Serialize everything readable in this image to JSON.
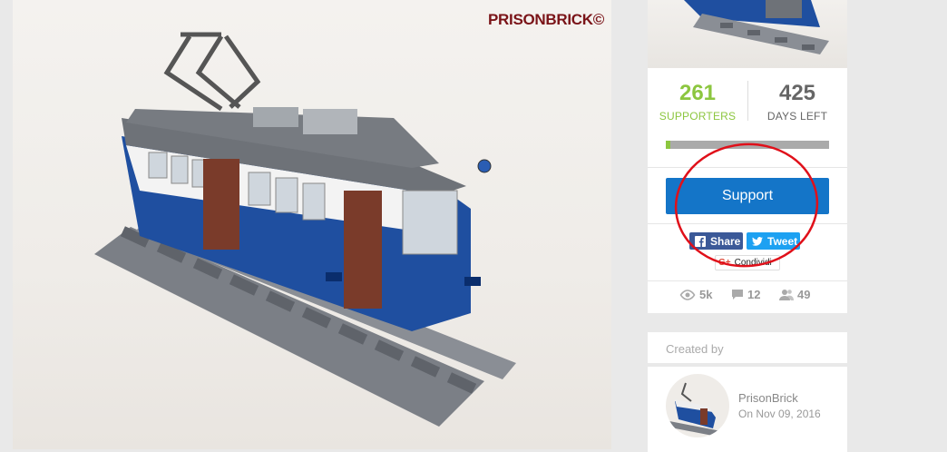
{
  "image": {
    "watermark": "PRISONBRICK©",
    "subject": "tram-model"
  },
  "stats": {
    "supporters_count": "261",
    "supporters_label": "SUPPORTERS",
    "days_left_count": "425",
    "days_left_label": "DAYS LEFT",
    "progress_fraction": 0.03
  },
  "support_button": {
    "label": "Support"
  },
  "share": {
    "facebook_label": "Share",
    "twitter_label": "Tweet",
    "gplus_label": "Condividi"
  },
  "meta": {
    "views": "5k",
    "comments": "12",
    "followers": "49"
  },
  "creator": {
    "header": "Created by",
    "name": "PrisonBrick",
    "date": "On Nov 09, 2016"
  },
  "colors": {
    "accent_green": "#8cc63f",
    "support_blue": "#1475c8",
    "facebook": "#3b5998",
    "twitter": "#1da1f2",
    "annotation_red": "#e0101a",
    "tram_blue": "#1f4fa0"
  }
}
